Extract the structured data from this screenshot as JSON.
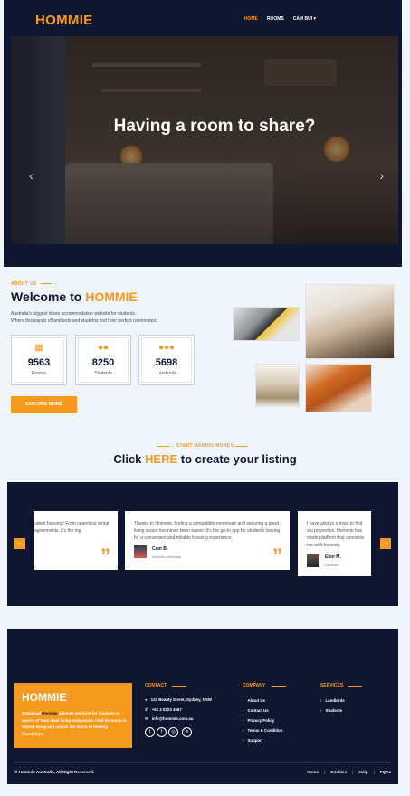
{
  "header": {
    "brand": "HOMMIE",
    "nav": [
      {
        "label": "HOME",
        "active": true
      },
      {
        "label": "ROOMS",
        "active": false
      },
      {
        "label": "CAM BUI",
        "active": false
      }
    ]
  },
  "hero": {
    "title": "Having a room to share?",
    "prev_icon": "chevron-left-icon",
    "next_icon": "chevron-right-icon"
  },
  "about": {
    "tag": "ABOUT US",
    "welcome_prefix": "Welcome to",
    "welcome_brand": "HOMMIE",
    "desc_line1": "Australia's biggest share accommodation website for students.",
    "desc_line2": "Where thousands of landlords and students find their perfect roommates.",
    "stats": [
      {
        "icon": "building-icon",
        "value": "9563",
        "label": "Rooms"
      },
      {
        "icon": "users-icon",
        "value": "8250",
        "label": "Students"
      },
      {
        "icon": "group-icon",
        "value": "5698",
        "label": "Landlords"
      }
    ],
    "explore_label": "EXPLORE MORE"
  },
  "cta": {
    "tag": "START MAKING MONEY",
    "prefix": "Click",
    "highlight": "HERE",
    "suffix": "to create your listing"
  },
  "testimonials": {
    "left_partial_text": "udent housing! From seamless rental agreements, it's the ing.",
    "cards": [
      {
        "text": "Thanks to Hommie, finding a compatible roommate and securing a great living space has never been easier. It's the go-to app for students looking for a convenient and reliable housing experience.",
        "name": "Cam B.",
        "subtitle": "Victoria University"
      },
      {
        "text": "I have always strived to find stu properties. Hommie has made platform that connects me with housing.",
        "name": "Elon M.",
        "subtitle": "Landlord"
      }
    ],
    "prev_icon": "arrow-left-icon",
    "next_icon": "arrow-right-icon"
  },
  "footer": {
    "brand": "HOMMIE",
    "desc_highlight": "Hommie",
    "desc_before": "Download",
    "desc_after": "ultimate platform for students in search of their ideal living companion. Find harmony in shared living and unlock the doors to lifelong friendships.",
    "contact": {
      "heading": "CONTACT",
      "address": "123 Beauty Street, Sydney, NSW",
      "phone": "+61 2 8123 4567",
      "email": "info@hommie.com.au"
    },
    "social": [
      "twitter-icon",
      "facebook-icon",
      "instagram-icon",
      "linkedin-icon"
    ],
    "company": {
      "heading": "COMPANY",
      "items": [
        "About Us",
        "Contact Us",
        "Privacy Policy",
        "Terms & Condition",
        "Support"
      ]
    },
    "services": {
      "heading": "SERVICES",
      "items": [
        "Landlords",
        "Students"
      ]
    },
    "copyright": "© Hommie Australia, All Right Reserved.",
    "links": [
      "Home",
      "Cookies",
      "Help",
      "FQAs"
    ]
  }
}
